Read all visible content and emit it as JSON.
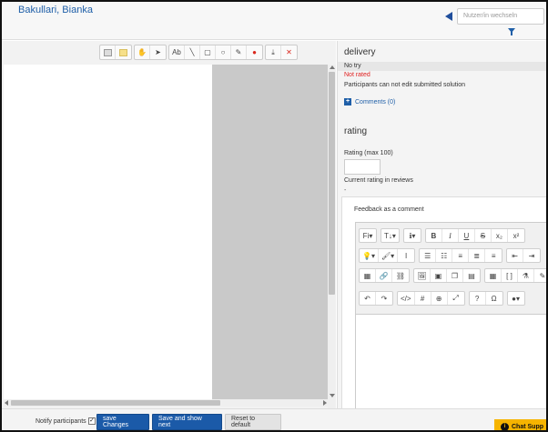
{
  "header": {
    "user_name": "Bakullari, Bianka",
    "user_switch_placeholder": "Nutzer/in wechseln"
  },
  "annotation_toolbar": {
    "icons": [
      "note-icon",
      "highlight-icon",
      "hand-icon",
      "pointer-icon",
      "stamp-text-icon",
      "line-icon",
      "rectangle-icon",
      "oval-icon",
      "pen-icon",
      "color-drop-icon",
      "download-icon",
      "delete-icon"
    ]
  },
  "delivery": {
    "title": "delivery",
    "status": "No try",
    "rating_status": "Not rated",
    "edit_note": "Participants can not edit submitted solution",
    "comments_link": "Comments (0)"
  },
  "rating": {
    "title": "rating",
    "max_label": "Rating (max 100)",
    "current_label": "Current rating in reviews",
    "current_value": "-"
  },
  "feedback": {
    "label": "Feedback as a comment",
    "toolbar": {
      "font_family": "Fi",
      "font_size": "T↓",
      "info": "ℹ",
      "bold": "B",
      "italic": "I",
      "underline": "U",
      "strikethrough": "S",
      "subscript": "x₂",
      "superscript": "x²",
      "undo": "↶",
      "redo": "↷",
      "code_view": "</>",
      "hash": "#",
      "zoom": "⊕",
      "fullscreen": "⤢"
    }
  },
  "footer": {
    "notify_label": "Notify participants",
    "notify_checked": true,
    "save_changes": "save Changes",
    "save_and_next": "Save and show next",
    "reset": "Reset to default"
  },
  "chat": {
    "label": "Chat Supp"
  },
  "colors": {
    "primary": "#1b5aa8",
    "link": "#1f5fa8",
    "error": "#e02020",
    "chat": "#f6b400"
  }
}
